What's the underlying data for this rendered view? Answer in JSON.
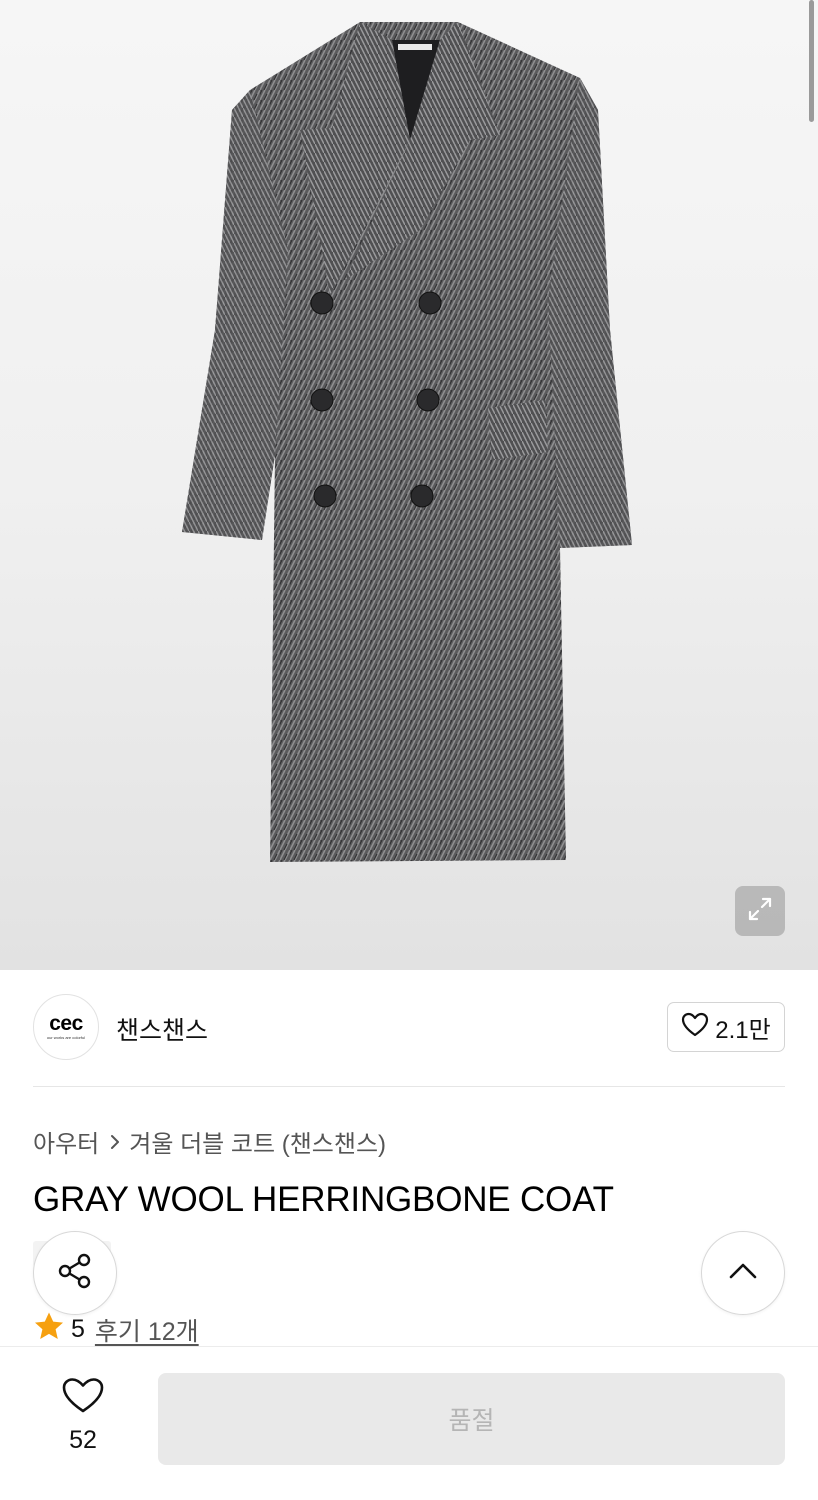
{
  "product_image": {
    "alt_icon": "gray-herringbone-double-breasted-coat"
  },
  "brand": {
    "logo_text": "cec",
    "logo_subtext": "our works are colorful",
    "name": "챈스챈스",
    "like_count": "2.1만"
  },
  "breadcrumb": {
    "category": "아우터",
    "subcategory": "겨울 더블 코트 (챈스챈스)"
  },
  "product": {
    "title": "GRAY WOOL HERRINGBONE COAT",
    "rating": "5",
    "review_label": "후기 12개"
  },
  "bottom_bar": {
    "wish_count": "52",
    "buy_label": "품절"
  },
  "colors": {
    "star": "#f6a010",
    "disabled_button": "#e9e9e9",
    "disabled_text": "#b5b5b5"
  }
}
